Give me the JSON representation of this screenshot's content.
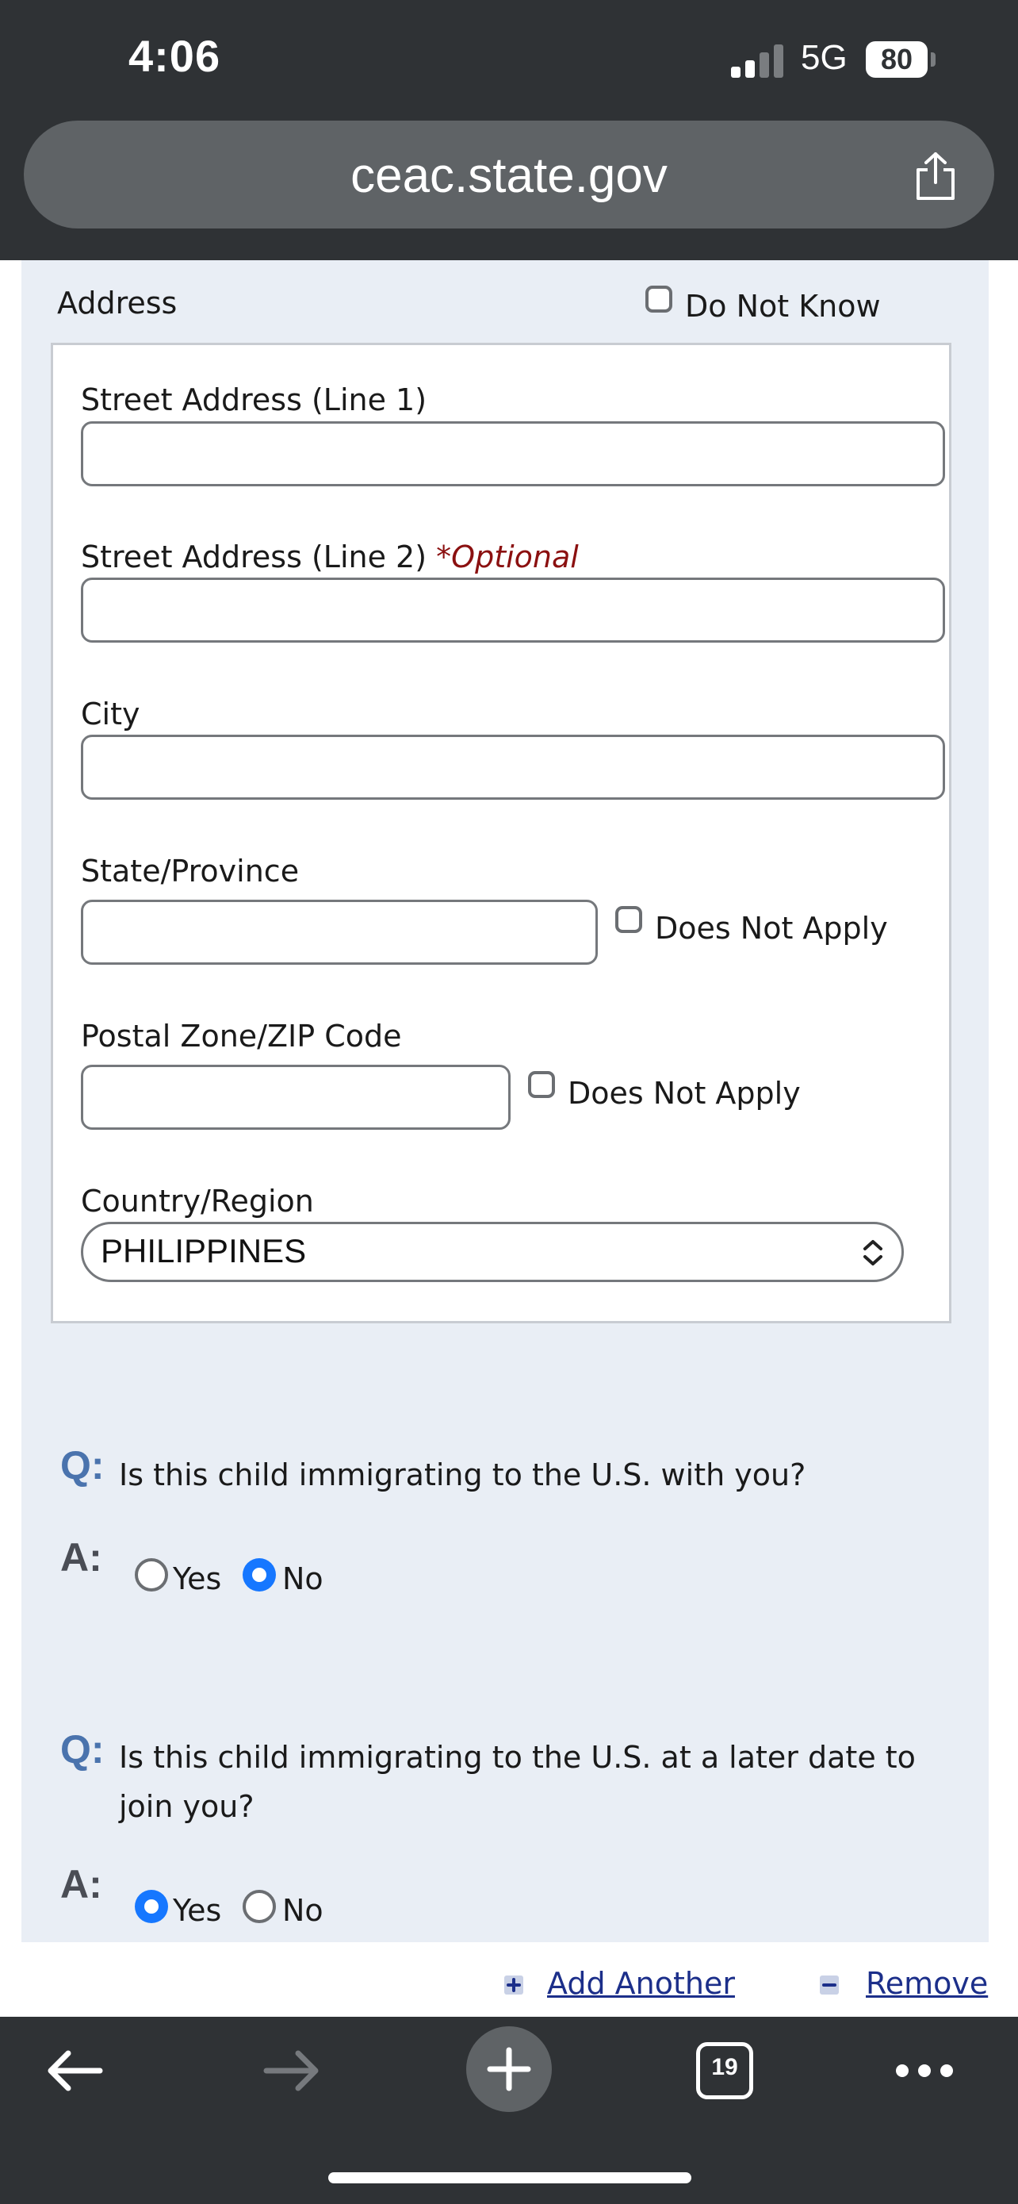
{
  "status_bar": {
    "time": "4:06",
    "network": "5G",
    "battery": "80"
  },
  "browser": {
    "url": "ceac.state.gov",
    "tab_count": "19"
  },
  "address": {
    "section_label": "Address",
    "do_not_know_label": "Do Not Know",
    "street1_label": "Street Address (Line 1)",
    "street1_value": "",
    "street2_label": "Street Address (Line 2)",
    "street2_optional": "*Optional",
    "street2_value": "",
    "city_label": "City",
    "city_value": "",
    "state_label": "State/Province",
    "state_value": "",
    "state_does_not_apply": "Does Not Apply",
    "postal_label": "Postal Zone/ZIP Code",
    "postal_value": "",
    "postal_does_not_apply": "Does Not Apply",
    "country_label": "Country/Region",
    "country_value": "PHILIPPINES"
  },
  "questions": [
    {
      "q_marker": "Q:",
      "a_marker": "A:",
      "text": "Is this child immigrating to the U.S. with you?",
      "options": [
        "Yes",
        "No"
      ],
      "selected": "No"
    },
    {
      "q_marker": "Q:",
      "a_marker": "A:",
      "text_line1": "Is this child immigrating to the U.S. at a later date to",
      "text_line2": "join you?",
      "options": [
        "Yes",
        "No"
      ],
      "selected": "Yes"
    }
  ],
  "actions": {
    "add_another": "Add Another",
    "remove": "Remove"
  },
  "colors": {
    "chrome_dark": "#2f3235",
    "form_background": "#e9eef5",
    "radio_selected": "#1677ff",
    "link": "#1c2f8a",
    "optional_text": "#8b1010",
    "question_marker": "#4a73ad"
  }
}
